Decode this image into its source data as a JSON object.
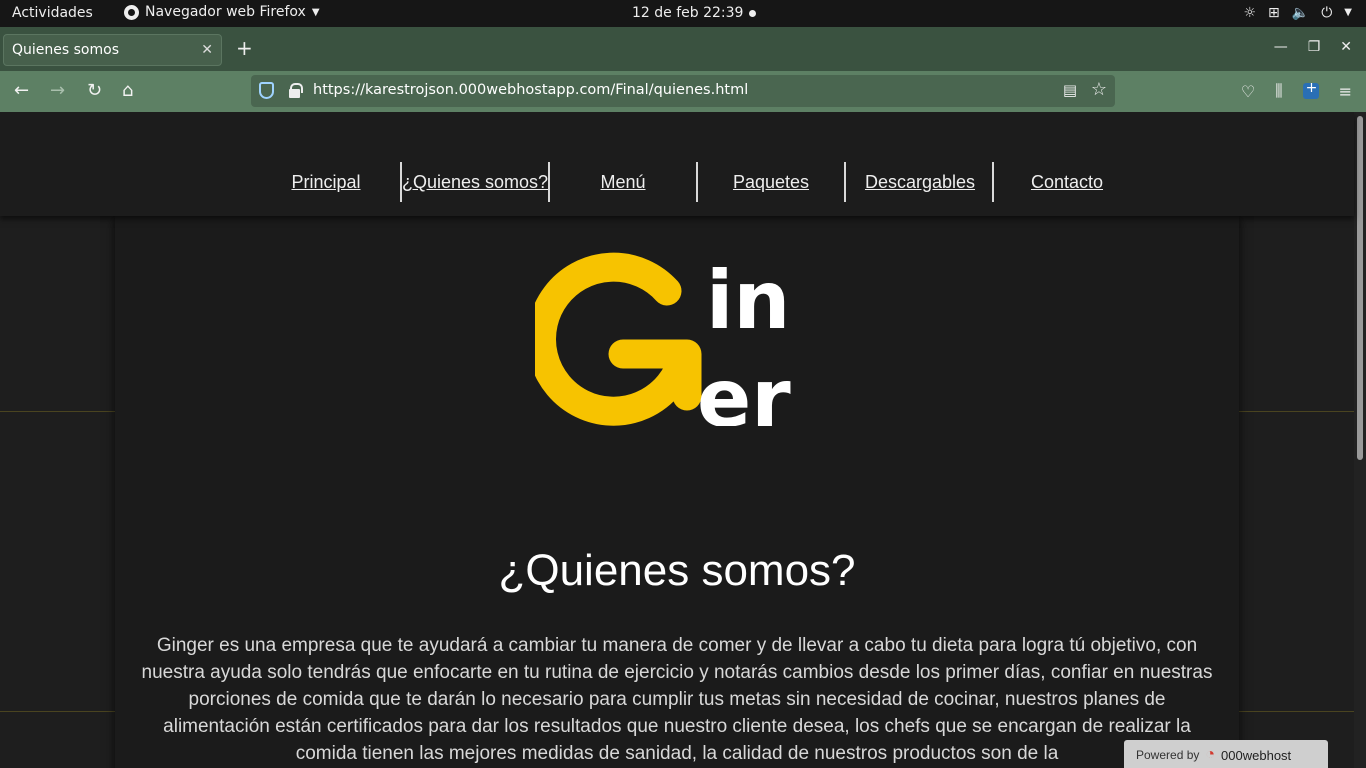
{
  "topbar": {
    "activities": "Actividades",
    "app_name": "Navegador web Firefox",
    "clock": "12 de feb  22:39"
  },
  "browser": {
    "tab_title": "Quienes somos",
    "url": "https://karestrojson.000webhostapp.com/Final/quienes.html"
  },
  "site": {
    "nav": [
      {
        "label": "Principal"
      },
      {
        "label": "¿Quienes somos?"
      },
      {
        "label": "Menú"
      },
      {
        "label": "Paquetes"
      },
      {
        "label": "Descargables"
      },
      {
        "label": "Contacto"
      }
    ],
    "logo_text": "Ginger",
    "heading": "¿Quienes somos?",
    "paragraph": "Ginger es una empresa que te ayudará a cambiar tu manera de comer y de llevar a cabo tu dieta para logra tú objetivo, con nuestra ayuda solo tendrás que enfocarte en tu rutina de ejercicio y notarás cambios desde los primer días, confiar en nuestras porciones de comida que te darán lo necesario para cumplir tus metas sin necesidad de cocinar, nuestros planes de alimentación están certificados para dar los resultados que nuestro cliente desea, los chefs que se encargan de realizar la comida tienen las mejores medidas de sanidad, la calidad de nuestros productos son de la"
  },
  "badge": {
    "powered": "Powered by",
    "brand": "000webhost"
  },
  "colors": {
    "logo_yellow": "#f7c300",
    "page_bg": "#1b1b1b",
    "toolbar_green": "#5d8064",
    "tabstrip_green": "#3a5240"
  }
}
